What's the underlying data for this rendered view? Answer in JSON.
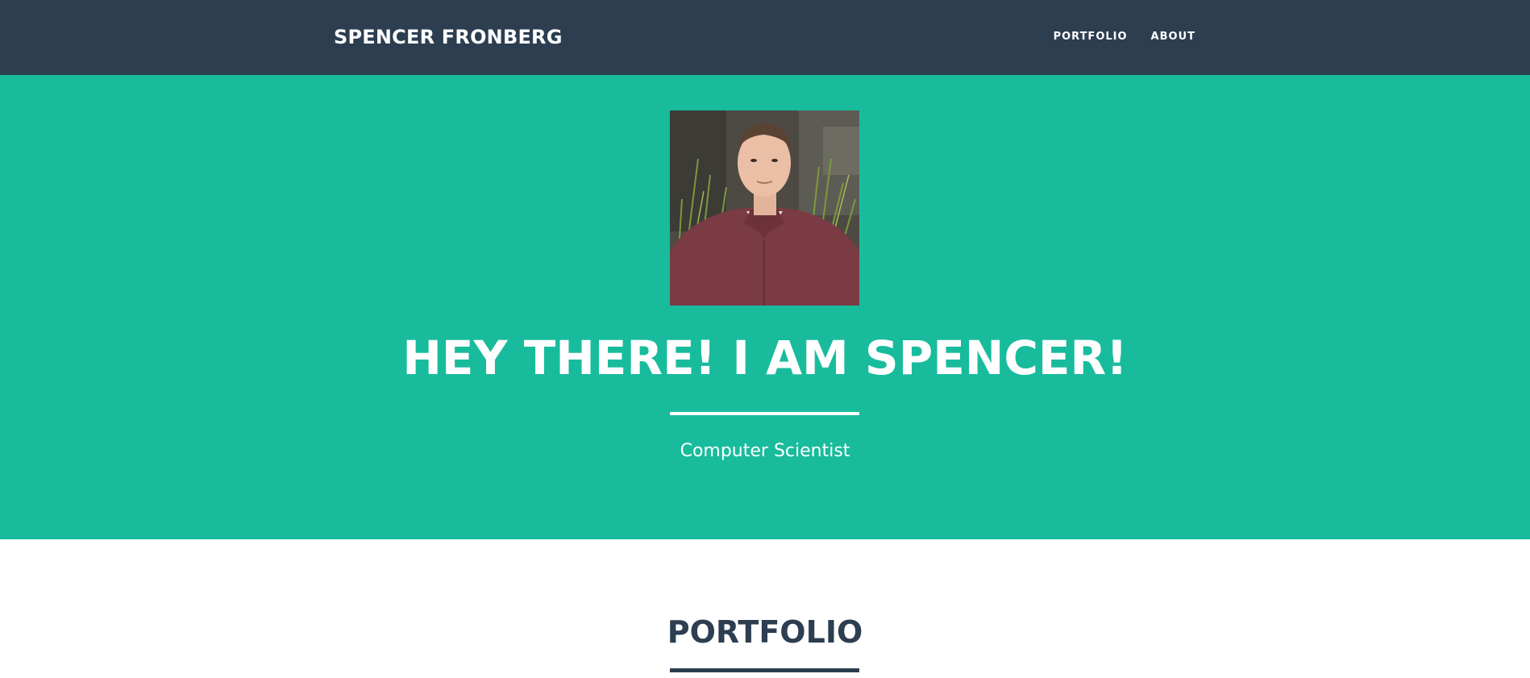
{
  "navbar": {
    "brand": "SPENCER FRONBERG",
    "links": [
      "PORTFOLIO",
      "ABOUT"
    ]
  },
  "masthead": {
    "title": "HEY THERE! I AM SPENCER!",
    "subtitle": "Computer Scientist"
  },
  "portfolio": {
    "title": "PORTFOLIO"
  },
  "colors": {
    "navbar_bg": "#2c3e50",
    "masthead_bg": "#18bc9c",
    "text_light": "#ffffff",
    "text_dark": "#2c3e50"
  }
}
